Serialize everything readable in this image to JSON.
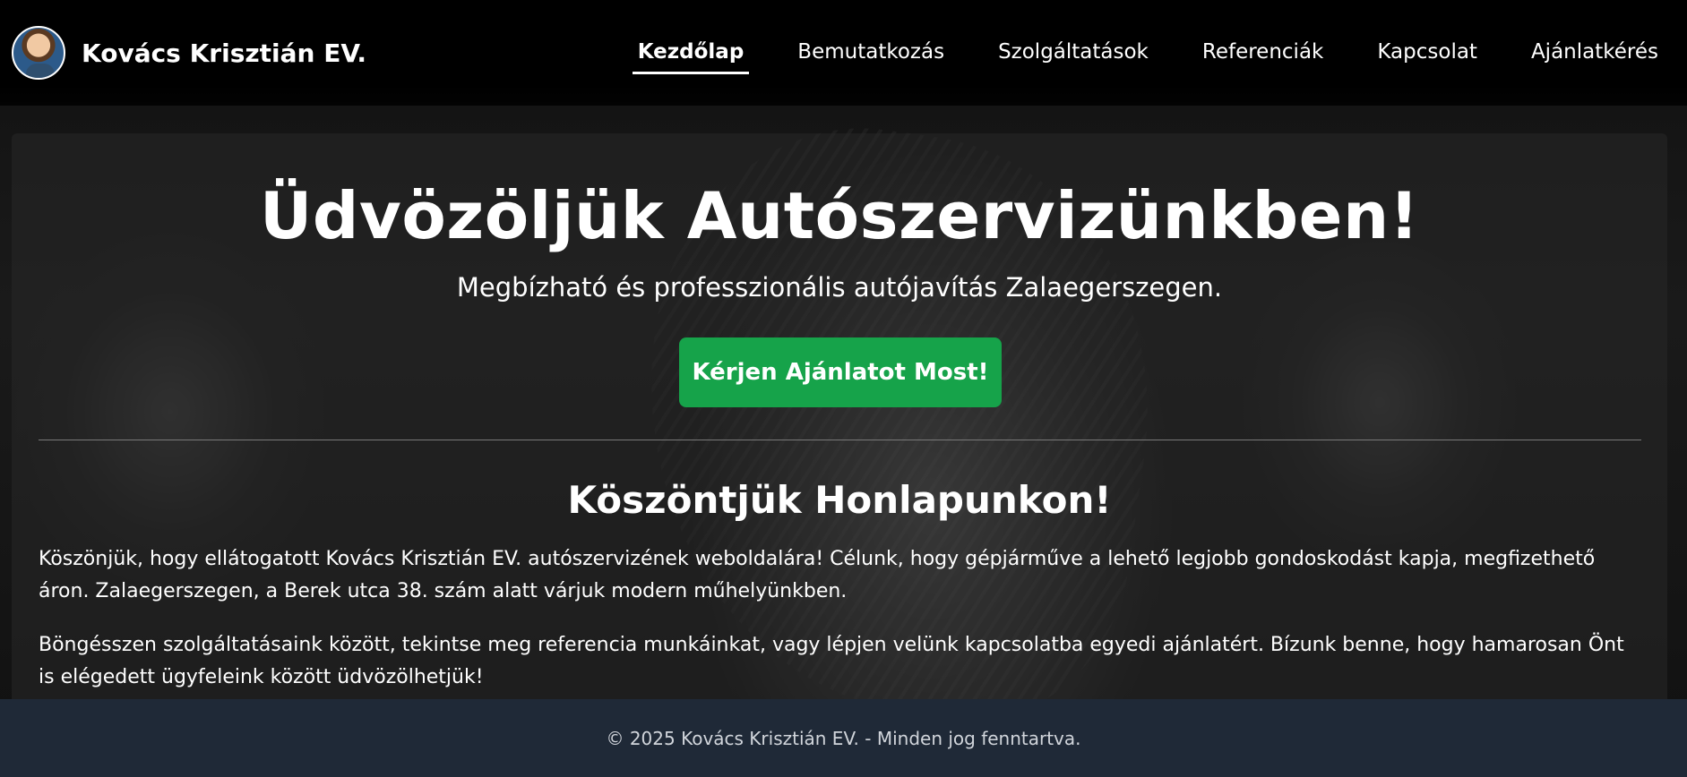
{
  "header": {
    "brand_name": "Kovács Krisztián EV.",
    "nav": [
      {
        "label": "Kezdőlap",
        "active": true
      },
      {
        "label": "Bemutatkozás"
      },
      {
        "label": "Szolgáltatások"
      },
      {
        "label": "Referenciák"
      },
      {
        "label": "Kapcsolat"
      },
      {
        "label": "Ajánlatkérés"
      }
    ]
  },
  "hero": {
    "title": "Üdvözöljük Autószervizünkben!",
    "subtitle": "Megbízható és professzionális autójavítás Zalaegerszegen.",
    "cta_label": "Kérjen Ajánlatot Most!"
  },
  "welcome": {
    "title": "Köszöntjük Honlapunkon!",
    "paragraphs": [
      "Köszönjük, hogy ellátogatott Kovács Krisztián EV. autószervizének weboldalára! Célunk, hogy gépjárműve a lehető legjobb gondoskodást kapja, megfizethető áron. Zalaegerszegen, a Berek utca 38. szám alatt várjuk modern műhelyünkben.",
      "Böngésszen szolgáltatásaink között, tekintse meg referencia munkáinkat, vagy lépjen velünk kapcsolatba egyedi ajánlatért. Bízunk benne, hogy hamarosan Önt is elégedett ügyfeleink között üdvözölhetjük!"
    ]
  },
  "footer": {
    "text": "© 2025 Kovács Krisztián EV. - Minden jog fenntartva."
  },
  "colors": {
    "accent": "#16a34a",
    "footer_bg": "#1f2937",
    "header_bg": "#000000"
  }
}
